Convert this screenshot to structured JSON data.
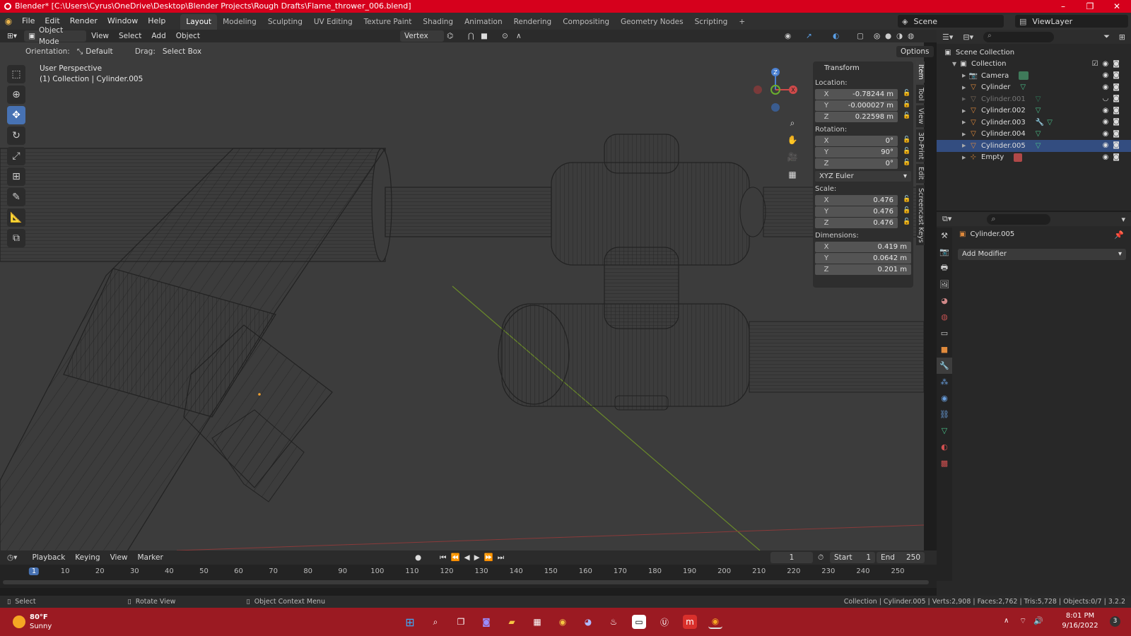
{
  "titlebar": {
    "title": "Blender* [C:\\Users\\Cyrus\\OneDrive\\Desktop\\Blender Projects\\Rough Drafts\\Flame_thrower_006.blend]"
  },
  "menu": {
    "items": [
      "File",
      "Edit",
      "Render",
      "Window",
      "Help"
    ]
  },
  "workspaces": [
    "Layout",
    "Modeling",
    "Sculpting",
    "UV Editing",
    "Texture Paint",
    "Shading",
    "Animation",
    "Rendering",
    "Compositing",
    "Geometry Nodes",
    "Scripting"
  ],
  "active_workspace": "Layout",
  "scene": {
    "name": "Scene",
    "viewlayer": "ViewLayer"
  },
  "viewheader": {
    "mode": "Object Mode",
    "menus": [
      "View",
      "Select",
      "Add",
      "Object"
    ],
    "snap_target": "Vertex",
    "options": "Options"
  },
  "viewheader2": {
    "orientation_label": "Orientation:",
    "orientation": "Default",
    "drag_label": "Drag:",
    "drag": "Select Box"
  },
  "viewport": {
    "line1": "User Perspective",
    "line2": "(1) Collection | Cylinder.005"
  },
  "gizmo": {
    "z": "Z",
    "y": "Y",
    "x": "X"
  },
  "transform": {
    "title": "Transform",
    "location_label": "Location:",
    "location": [
      {
        "axis": "X",
        "value": "-0.78244 m"
      },
      {
        "axis": "Y",
        "value": "-0.000027 m"
      },
      {
        "axis": "Z",
        "value": "0.22598 m"
      }
    ],
    "rotation_label": "Rotation:",
    "rotation": [
      {
        "axis": "X",
        "value": "0°"
      },
      {
        "axis": "Y",
        "value": "90°"
      },
      {
        "axis": "Z",
        "value": "0°"
      }
    ],
    "rotation_mode": "XYZ Euler",
    "scale_label": "Scale:",
    "scale": [
      {
        "axis": "X",
        "value": "0.476"
      },
      {
        "axis": "Y",
        "value": "0.476"
      },
      {
        "axis": "Z",
        "value": "0.476"
      }
    ],
    "dimensions_label": "Dimensions:",
    "dimensions": [
      {
        "axis": "X",
        "value": "0.419 m"
      },
      {
        "axis": "Y",
        "value": "0.0642 m"
      },
      {
        "axis": "Z",
        "value": "0.201 m"
      }
    ]
  },
  "npanel_tabs": [
    "Item",
    "Tool",
    "View",
    "3D-Print",
    "Edit",
    "Screencast Keys"
  ],
  "outliner": {
    "scene_collection": "Scene Collection",
    "collection": "Collection",
    "items": [
      {
        "name": "Camera",
        "icon": "camera-icon",
        "color": "#c98a4b"
      },
      {
        "name": "Cylinder",
        "icon": "mesh-icon",
        "color": "#e08a3c"
      },
      {
        "name": "Cylinder.001",
        "icon": "mesh-icon",
        "color": "#7a6a5a"
      },
      {
        "name": "Cylinder.002",
        "icon": "mesh-icon",
        "color": "#e08a3c"
      },
      {
        "name": "Cylinder.003",
        "icon": "mesh-icon",
        "color": "#e08a3c"
      },
      {
        "name": "Cylinder.004",
        "icon": "mesh-icon",
        "color": "#e08a3c"
      },
      {
        "name": "Cylinder.005",
        "icon": "mesh-icon",
        "color": "#e08a3c"
      },
      {
        "name": "Empty",
        "icon": "empty-icon",
        "color": "#e08a3c"
      }
    ]
  },
  "properties": {
    "object": "Cylinder.005",
    "add_modifier": "Add Modifier"
  },
  "timeline": {
    "menus": [
      "Playback",
      "Keying",
      "View",
      "Marker"
    ],
    "current_frame": "1",
    "start_label": "Start",
    "start": "1",
    "end_label": "End",
    "end": "250",
    "ticks": [
      "1",
      "10",
      "20",
      "30",
      "40",
      "50",
      "60",
      "70",
      "80",
      "90",
      "100",
      "110",
      "120",
      "130",
      "140",
      "150",
      "160",
      "170",
      "180",
      "190",
      "200",
      "210",
      "220",
      "230",
      "240",
      "250"
    ]
  },
  "statusbar": {
    "select": "Select",
    "rotate": "Rotate View",
    "context": "Object Context Menu",
    "info": "Collection | Cylinder.005 | Verts:2,908 | Faces:2,762 | Tris:5,728 | Objects:0/7 | 3.2.2"
  },
  "taskbar": {
    "temp": "80°F",
    "weather": "Sunny",
    "time": "8:01 PM",
    "date": "9/16/2022",
    "badge": "3"
  }
}
